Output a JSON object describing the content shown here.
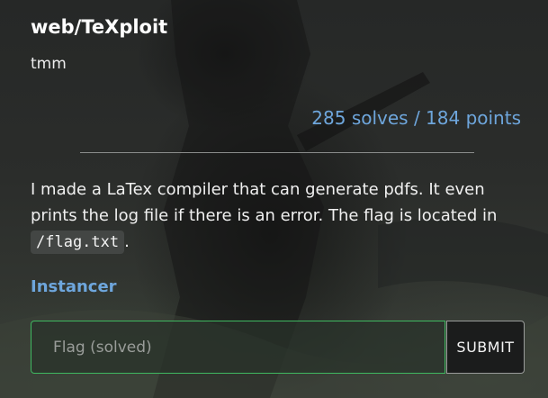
{
  "challenge": {
    "title": "web/TeXploit",
    "author": "tmm",
    "stats": "285 solves / 184 points",
    "description_text": "I made a LaTex compiler that can generate pdfs. It even prints the log file if there is an error. The flag is located in ",
    "description_code": "/flag.txt",
    "description_end": "."
  },
  "instancer": {
    "label": "Instancer"
  },
  "flag_form": {
    "placeholder": "Flag (solved)",
    "value": "",
    "submit_label": "SUBMIT"
  },
  "colors": {
    "accent": "#6ea6dc",
    "success_border": "#3fb860",
    "background": "#2b2d2b"
  }
}
